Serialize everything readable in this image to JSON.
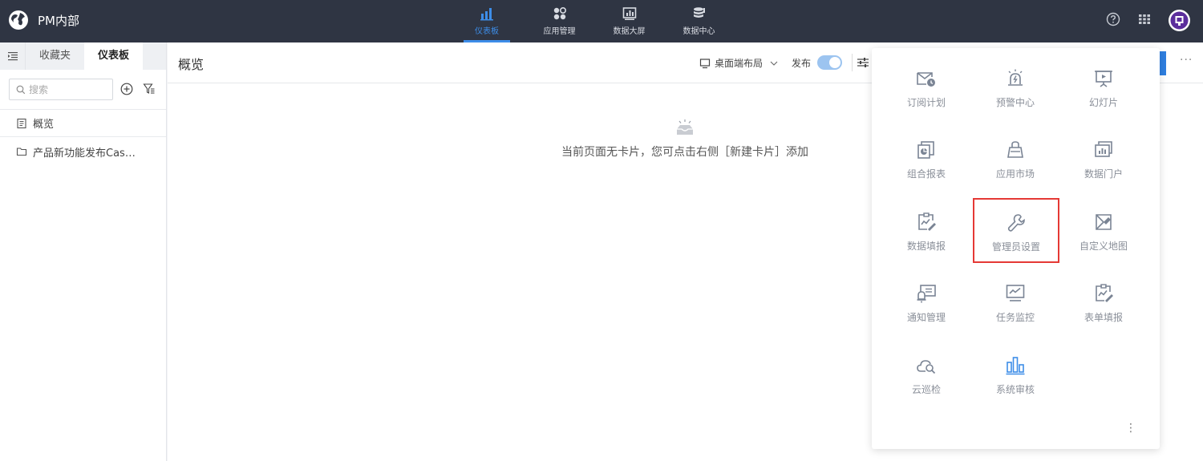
{
  "header": {
    "brand_name": "PM内部",
    "nav": [
      {
        "label": "仪表板",
        "icon": "bar-chart-icon",
        "active": true
      },
      {
        "label": "应用管理",
        "icon": "apps-dots-icon",
        "active": false
      },
      {
        "label": "数据大屏",
        "icon": "screen-chart-icon",
        "active": false
      },
      {
        "label": "数据中心",
        "icon": "database-icon",
        "active": false
      }
    ],
    "right_icons": [
      "help-icon",
      "app-grid-icon",
      "avatar"
    ]
  },
  "sidebar": {
    "tabs": [
      {
        "label": "收藏夹",
        "active": false
      },
      {
        "label": "仪表板",
        "active": true
      }
    ],
    "search_placeholder": "搜索",
    "items": [
      {
        "label": "概览",
        "icon": "document-icon"
      },
      {
        "label": "产品新功能发布Cas…",
        "icon": "folder-icon"
      }
    ]
  },
  "main": {
    "title": "概览",
    "layout_label": "桌面端布局",
    "publish_label": "发布",
    "publish_on": true,
    "empty_message": "当前页面无卡片，您可点击右侧［新建卡片］添加"
  },
  "app_panel": {
    "items": [
      {
        "label": "订阅计划",
        "icon": "mail-clock-icon"
      },
      {
        "label": "预警中心",
        "icon": "alarm-icon"
      },
      {
        "label": "幻灯片",
        "icon": "presentation-icon"
      },
      {
        "label": "组合报表",
        "icon": "combo-report-icon"
      },
      {
        "label": "应用市场",
        "icon": "shop-bag-icon"
      },
      {
        "label": "数据门户",
        "icon": "data-portal-icon"
      },
      {
        "label": "数据填报",
        "icon": "data-fill-icon"
      },
      {
        "label": "管理员设置",
        "icon": "wrench-icon",
        "highlighted": true
      },
      {
        "label": "自定义地图",
        "icon": "custom-map-icon"
      },
      {
        "label": "通知管理",
        "icon": "notification-icon"
      },
      {
        "label": "任务监控",
        "icon": "monitor-icon"
      },
      {
        "label": "表单填报",
        "icon": "form-fill-icon"
      },
      {
        "label": "云巡检",
        "icon": "cloud-inspect-icon"
      },
      {
        "label": "系统审核",
        "icon": "system-audit-icon"
      }
    ]
  },
  "colors": {
    "topbar_bg": "#2f3543",
    "accent": "#3d8de8",
    "highlight_border": "#e53935"
  }
}
